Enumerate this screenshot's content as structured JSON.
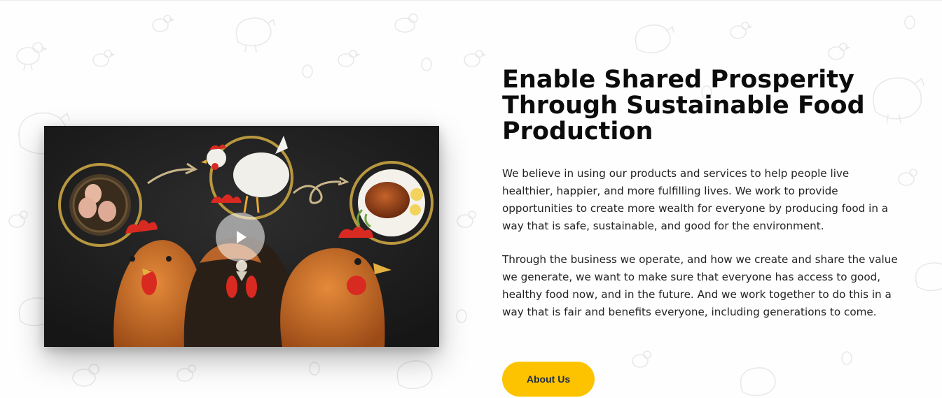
{
  "section": {
    "headline": "Enable Shared Prosperity Through Sustainable Food Production",
    "paragraphs": [
      "We believe in using our products and services to help people live healthier, happier, and more fulfilling lives. We work to provide opportunities to create more wealth for everyone by producing food in a way that is safe, sustainable, and good for the environment.",
      "Through the business we operate, and how we create and share the value we generate, we want to make sure that everyone has access to good, healthy food now, and in the future. And we work together to do this in a way that is fair and benefits everyone, including generations to come."
    ],
    "cta_label": "About Us"
  },
  "video": {
    "play_icon": "play-icon",
    "scene_icons": [
      "egg-nest-icon",
      "arrow-icon",
      "white-hen-icon",
      "curly-arrow-icon",
      "roast-chicken-icon",
      "hen-head-icon"
    ]
  },
  "colors": {
    "accent": "#fdc300",
    "button_text": "#1b2a4a",
    "headline": "#0c0c0c",
    "body_text": "#222222",
    "video_bg": "#1d1d1d",
    "ring_gold": "#b8973f"
  }
}
